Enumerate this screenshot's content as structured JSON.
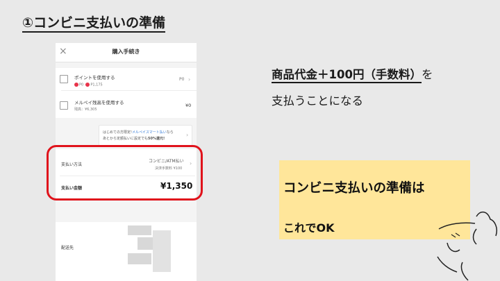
{
  "slide": {
    "title": "①コンビニ支払いの準備"
  },
  "screen": {
    "header": {
      "close_symbol": "×",
      "title": "購入手続き"
    },
    "points": {
      "label": "ポイントを使用する",
      "p_mark": "P",
      "points_value": "P0",
      "p1_value": "P1,175",
      "right_value": "P0"
    },
    "merpay": {
      "label": "メルペイ残高を使用する",
      "balance": "残高：¥6,305",
      "right_value": "¥0"
    },
    "promo": {
      "line1_pre": "はじめての方限定!",
      "line1_link": "メルペイスマート払い",
      "line1_post": "なら",
      "line2_pre": "あとから定額払いに設定でも",
      "line2_bold": "50%還元!"
    },
    "payment": {
      "label": "支払い方法",
      "method": "コンビニ/ATM払い",
      "fee": "決済手数料 ¥100"
    },
    "total": {
      "label": "支払い金額",
      "amount": "¥1,350"
    },
    "shipping": {
      "label": "配送先"
    }
  },
  "explanation": {
    "line1_underlined": "商品代金＋100円（手数料）",
    "line1_tail": "を",
    "line2": "支払うことになる"
  },
  "note": {
    "line1": "コンビニ支払いの準備は",
    "line2": "これでOK"
  },
  "colors": {
    "highlight_frame": "#e0121b",
    "note_background": "#ffe69a",
    "link_blue": "#3a7fd8",
    "point_red": "#e8344a"
  }
}
